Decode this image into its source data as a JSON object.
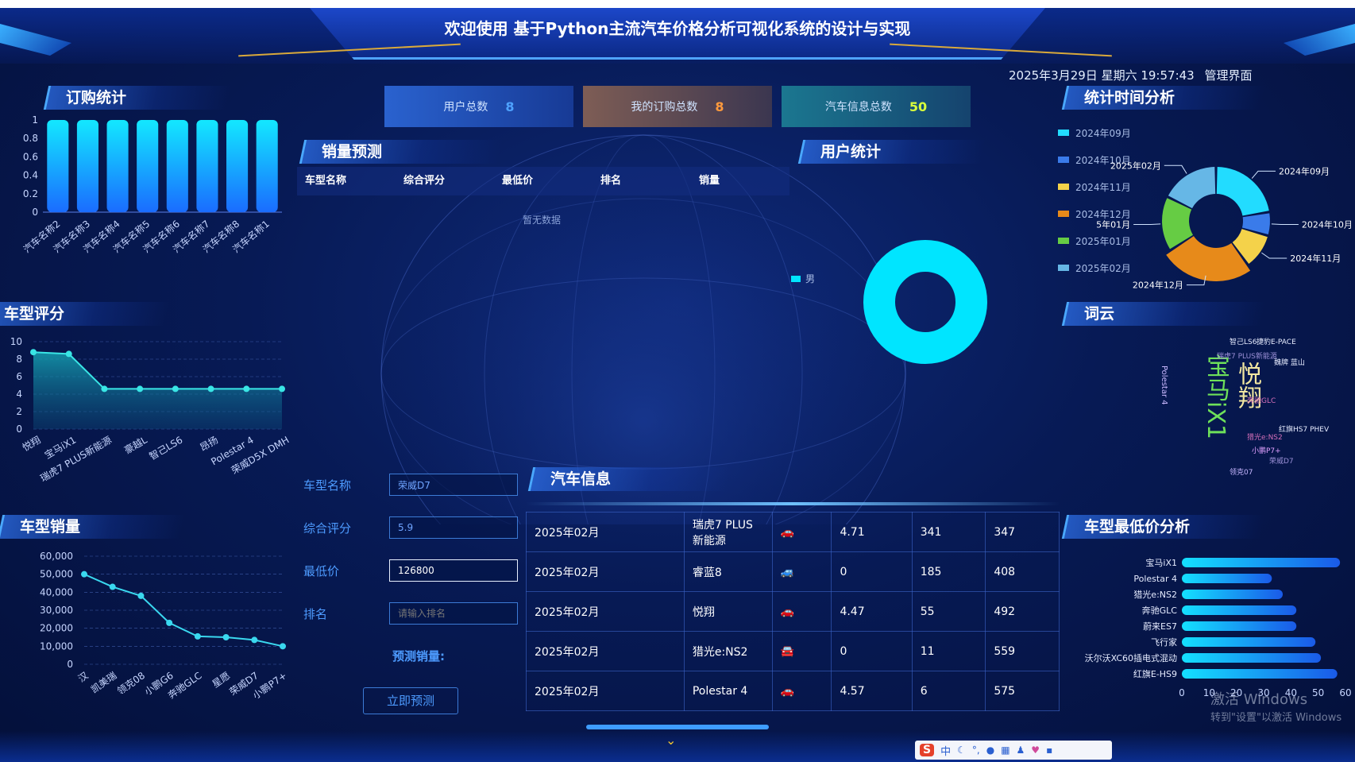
{
  "header": {
    "title": "欢迎使用 基于Python主流汽车价格分析可视化系统的设计与实现",
    "datetime": "2025年3月29日 星期六 19:57:43",
    "admin_link": "管理界面"
  },
  "stats": [
    {
      "label": "用户总数",
      "value": "8",
      "color": "#2f6fd8",
      "value_color": "#4ea2ff"
    },
    {
      "label": "我的订购总数",
      "value": "8",
      "color": "#7a5a52",
      "value_color": "#ff9a3c"
    },
    {
      "label": "汽车信息总数",
      "value": "50",
      "color": "#1a6f86",
      "value_color": "#d9ff3c"
    }
  ],
  "panels": {
    "order_stats": "订购统计",
    "model_score": "车型评分",
    "model_sales": "车型销量",
    "sales_forecast": "销量预测",
    "user_stats": "用户统计",
    "time_analysis": "统计时间分析",
    "word_cloud": "词云",
    "car_info": "汽车信息",
    "min_price_analysis": "车型最低价分析"
  },
  "forecast_table": {
    "headers": [
      "车型名称",
      "综合评分",
      "最低价",
      "排名",
      "销量"
    ],
    "empty_text": "暂无数据"
  },
  "forecast_form": {
    "fields": [
      {
        "label": "车型名称",
        "value": "荣威D7",
        "placeholder": ""
      },
      {
        "label": "综合评分",
        "value": "5.9",
        "placeholder": ""
      },
      {
        "label": "最低价",
        "value": "126800",
        "placeholder": ""
      },
      {
        "label": "排名",
        "value": "",
        "placeholder": "请输入排名"
      }
    ],
    "result_label": "预测销量:",
    "submit_label": "立即预测"
  },
  "car_table": {
    "rows": [
      {
        "date": "2025年02月",
        "name": "瑞虎7 PLUS新能源",
        "score": "4.71",
        "rank": "341",
        "sales": "347"
      },
      {
        "date": "2025年02月",
        "name": "睿蓝8",
        "score": "0",
        "rank": "185",
        "sales": "408"
      },
      {
        "date": "2025年02月",
        "name": "悦翔",
        "score": "4.47",
        "rank": "55",
        "sales": "492"
      },
      {
        "date": "2025年02月",
        "name": "猎光e:NS2",
        "score": "0",
        "rank": "11",
        "sales": "559"
      },
      {
        "date": "2025年02月",
        "name": "Polestar 4",
        "score": "4.57",
        "rank": "6",
        "sales": "575"
      }
    ]
  },
  "user_legend": "男",
  "windows_watermark": {
    "line1": "激活 Windows",
    "line2": "转到\"设置\"以激活 Windows"
  },
  "chart_data": [
    {
      "id": "order",
      "type": "bar",
      "categories": [
        "汽车名称2",
        "汽车名称3",
        "汽车名称4",
        "汽车名称5",
        "汽车名称6",
        "汽车名称7",
        "汽车名称8",
        "汽车名称1"
      ],
      "values": [
        1,
        1,
        1,
        1,
        1,
        1,
        1,
        1
      ],
      "ylim": [
        0,
        1
      ],
      "yticks": [
        "1",
        "0.8",
        "0.6",
        "0.4",
        "0.2",
        "0"
      ]
    },
    {
      "id": "score",
      "type": "area",
      "categories": [
        "悦翔",
        "宝马iX1",
        "瑞虎7 PLUS新能源",
        "豪越L",
        "智己LS6",
        "昂扬",
        "Polestar 4",
        "荣威D5X DMH"
      ],
      "values": [
        8.8,
        8.6,
        4.6,
        4.6,
        4.6,
        4.6,
        4.6,
        4.6
      ],
      "ylim": [
        0,
        10
      ],
      "yticks": [
        "10",
        "8",
        "6",
        "4",
        "2",
        "0"
      ]
    },
    {
      "id": "sales",
      "type": "line",
      "categories": [
        "汉",
        "凯美瑞",
        "领克08",
        "小鹏G6",
        "奔驰GLC",
        "星愿",
        "荣威D7",
        "小鹏P7+"
      ],
      "values": [
        50000,
        43000,
        38000,
        23000,
        15500,
        15000,
        13500,
        10000
      ],
      "ylim": [
        0,
        60000
      ],
      "yticks": [
        "60,000",
        "50,000",
        "40,000",
        "30,000",
        "20,000",
        "10,000",
        "0"
      ]
    },
    {
      "id": "user",
      "type": "pie",
      "categories": [
        "男"
      ],
      "values": [
        1
      ]
    },
    {
      "id": "time",
      "type": "pie",
      "categories": [
        "2024年09月",
        "2024年10月",
        "2024年11月",
        "2024年12月",
        "2025年01月",
        "2025年02月"
      ],
      "colors": [
        "#22dcff",
        "#3a7bea",
        "#f4d24a",
        "#e78a1a",
        "#66cc44",
        "#66b7e6"
      ],
      "values": [
        19,
        6,
        9,
        22,
        14,
        15
      ]
    },
    {
      "id": "min_price",
      "type": "bar",
      "categories": [
        "宝马iX1",
        "Polestar 4",
        "猎光e:NS2",
        "奔驰GLC",
        "蔚来ES7",
        "飞行家",
        "沃尔沃XC60插电式混动",
        "红旗E-HS9"
      ],
      "values": [
        58,
        33,
        37,
        42,
        42,
        49,
        51,
        57
      ],
      "xlim": [
        0,
        60
      ],
      "xticks": [
        "0",
        "10",
        "20",
        "30",
        "40",
        "50",
        "60"
      ]
    }
  ],
  "word_cloud_words": [
    {
      "text": "宝马iX1",
      "color": "#6ee05a",
      "size": 30,
      "vertical": true
    },
    {
      "text": "悦翔",
      "color": "#f1e6a0",
      "size": 30,
      "vertical": true
    },
    {
      "text": "智己LS6",
      "color": "#e7ecff",
      "size": 9
    },
    {
      "text": "捷豹E-PACE",
      "color": "#e7ecff",
      "size": 9
    },
    {
      "text": "瑞虎7 PLUS新能源",
      "color": "#9a8fd6",
      "size": 9
    },
    {
      "text": "魏牌 蓝山",
      "color": "#e7ecff",
      "size": 9
    },
    {
      "text": "奔驰GLC",
      "color": "#d56fb9",
      "size": 9
    },
    {
      "text": "红旗HS7 PHEV",
      "color": "#e7ecff",
      "size": 9
    },
    {
      "text": "Polestar 4",
      "color": "#c9b8ff",
      "size": 10,
      "vertical": true
    },
    {
      "text": "荣威D7",
      "color": "#9a8fd6",
      "size": 9
    },
    {
      "text": "小鹏P7+",
      "color": "#e0a0ff",
      "size": 9
    },
    {
      "text": "领克07",
      "color": "#c7b6ff",
      "size": 9
    },
    {
      "text": "猎光e:NS2",
      "color": "#d56fb9",
      "size": 9
    }
  ]
}
